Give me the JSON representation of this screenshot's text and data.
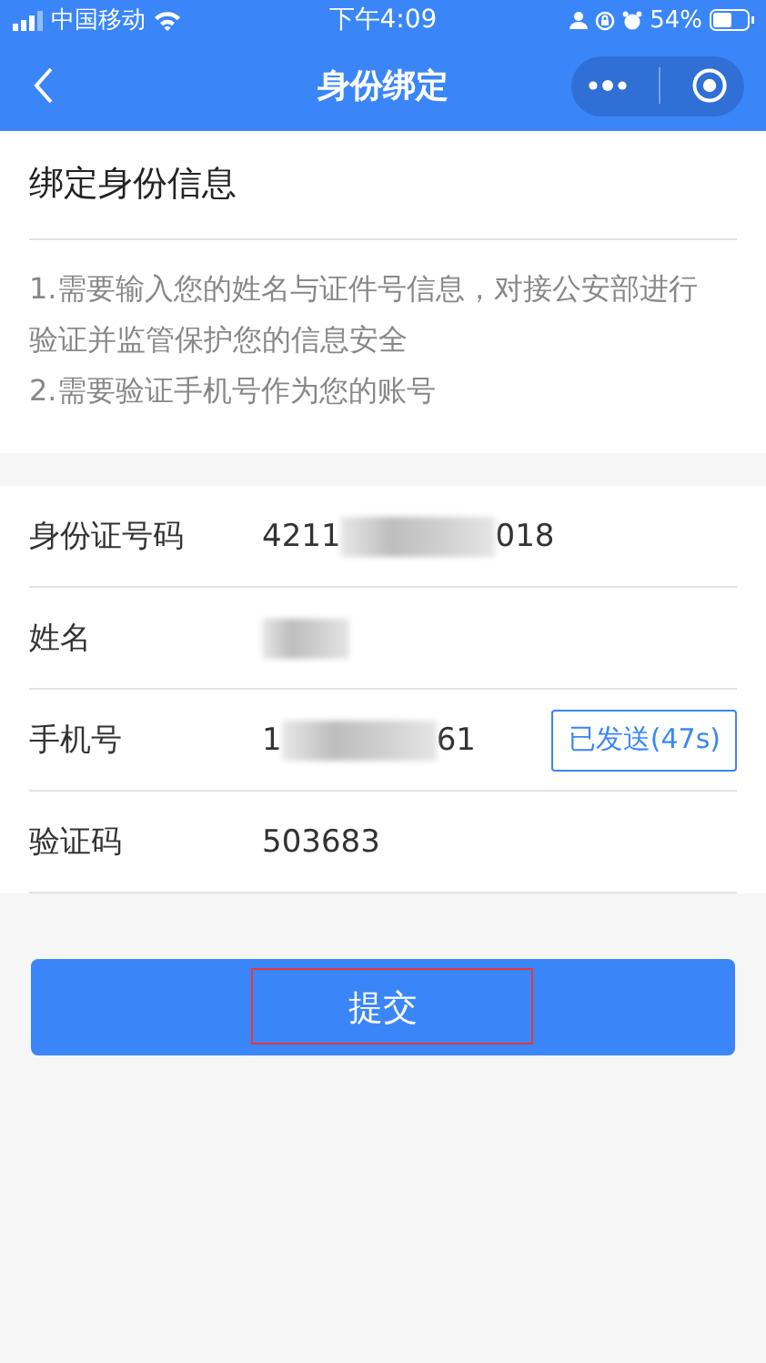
{
  "status_bar": {
    "carrier": "中国移动",
    "time": "下午4:09",
    "battery": "54%"
  },
  "nav": {
    "title": "身份绑定"
  },
  "intro": {
    "title": "绑定身份信息",
    "lines": [
      "1.需要输入您的姓名与证件号信息，对接公安部进行验证并监管保护您的信息安全",
      "2.需要验证手机号作为您的账号"
    ]
  },
  "fields": [
    {
      "label": "身份证号码",
      "kind": "masked",
      "visible_start": "4211",
      "visible_end": "018"
    },
    {
      "label": "姓名",
      "kind": "masked"
    },
    {
      "label": "手机号",
      "kind": "masked",
      "visible_start": "1",
      "visible_end": "61",
      "button": {
        "label": "已发送(47s)"
      }
    },
    {
      "label": "验证码",
      "kind": "text",
      "value": "503683"
    }
  ],
  "submit": {
    "label": "提交",
    "highlighted": true
  }
}
